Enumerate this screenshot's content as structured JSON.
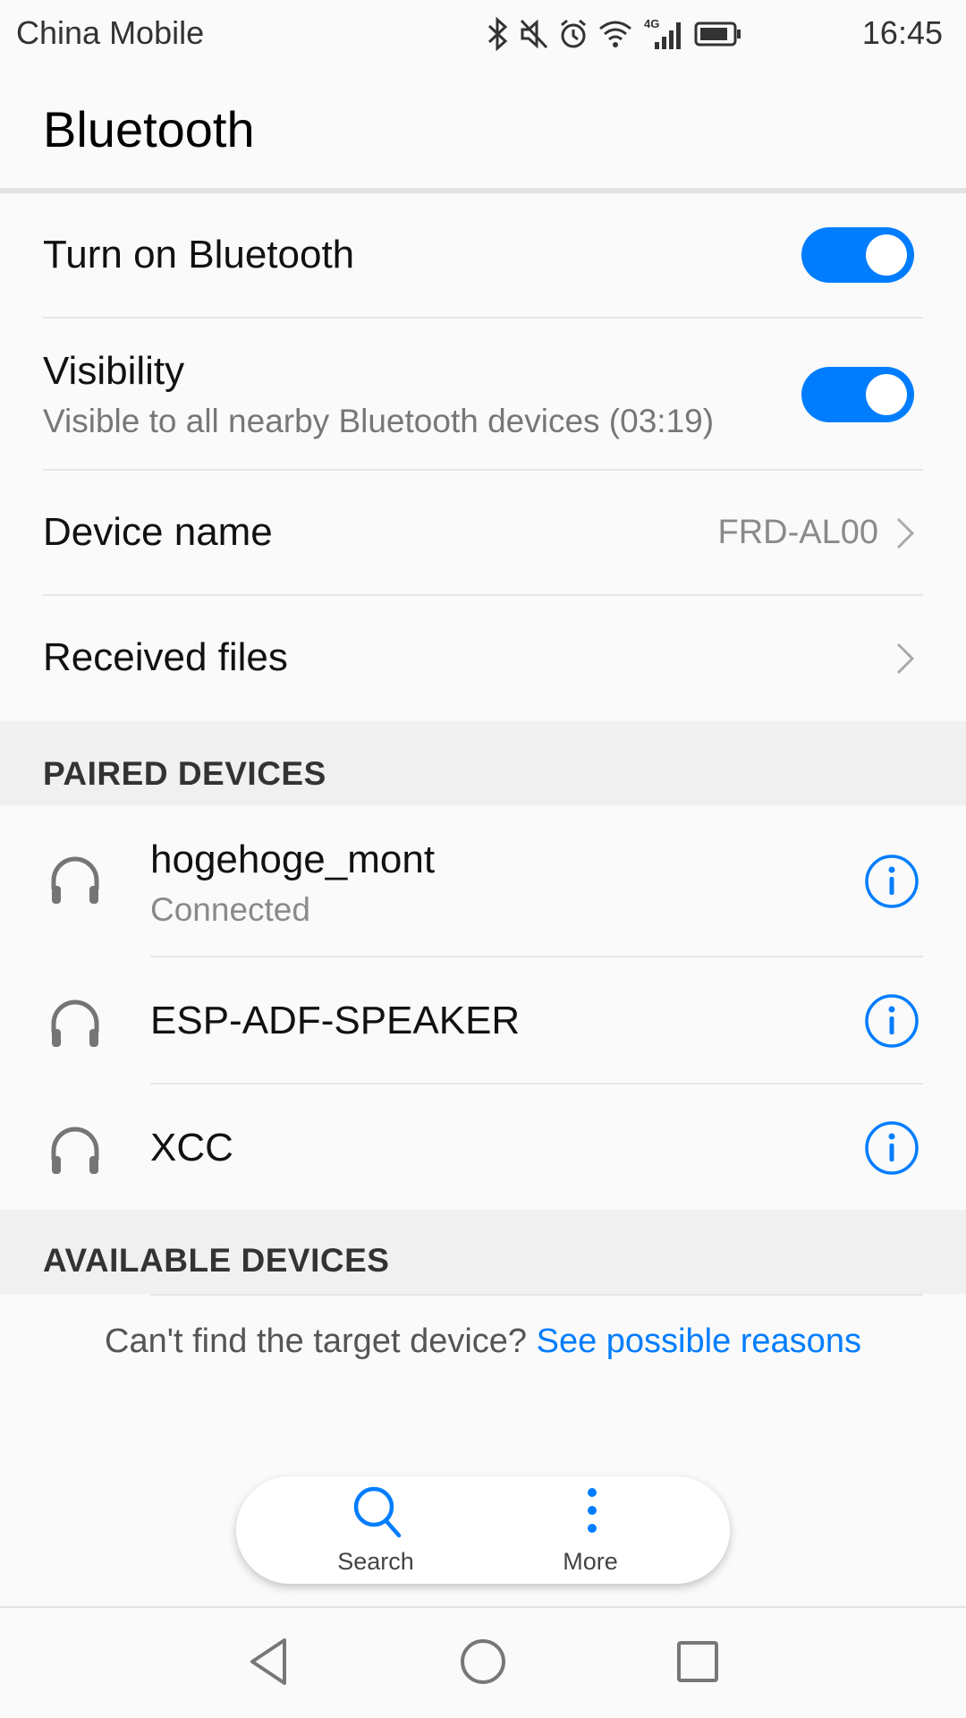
{
  "status_bar": {
    "carrier": "China Mobile",
    "time": "16:45",
    "network": "4G",
    "icons": [
      "bluetooth-icon",
      "mute-icon",
      "alarm-icon",
      "wifi-icon",
      "signal-icon",
      "battery-icon"
    ]
  },
  "header": {
    "title": "Bluetooth"
  },
  "settings": {
    "bluetooth_toggle": {
      "label": "Turn on Bluetooth",
      "on": true
    },
    "visibility": {
      "label": "Visibility",
      "subtitle": "Visible to all nearby Bluetooth devices (03:19)",
      "on": true
    },
    "device_name": {
      "label": "Device name",
      "value": "FRD-AL00"
    },
    "received_files": {
      "label": "Received files"
    }
  },
  "paired_devices": {
    "title": "PAIRED DEVICES",
    "items": [
      {
        "name": "hogehoge_mont",
        "status": "Connected",
        "icon": "headphones-icon"
      },
      {
        "name": "ESP-ADF-SPEAKER",
        "icon": "headphones-icon"
      },
      {
        "name": "XCC",
        "icon": "headphones-icon"
      }
    ]
  },
  "available_devices": {
    "title": "AVAILABLE DEVICES",
    "hint": "Can't find the target device?",
    "hint_link": "See possible reasons"
  },
  "actions": {
    "search_label": "Search",
    "more_label": "More"
  },
  "colors": {
    "accent": "#007dff",
    "toggle_on": "#007dff",
    "section_bg": "#f0f0f0",
    "icon_gray": "#757575"
  }
}
